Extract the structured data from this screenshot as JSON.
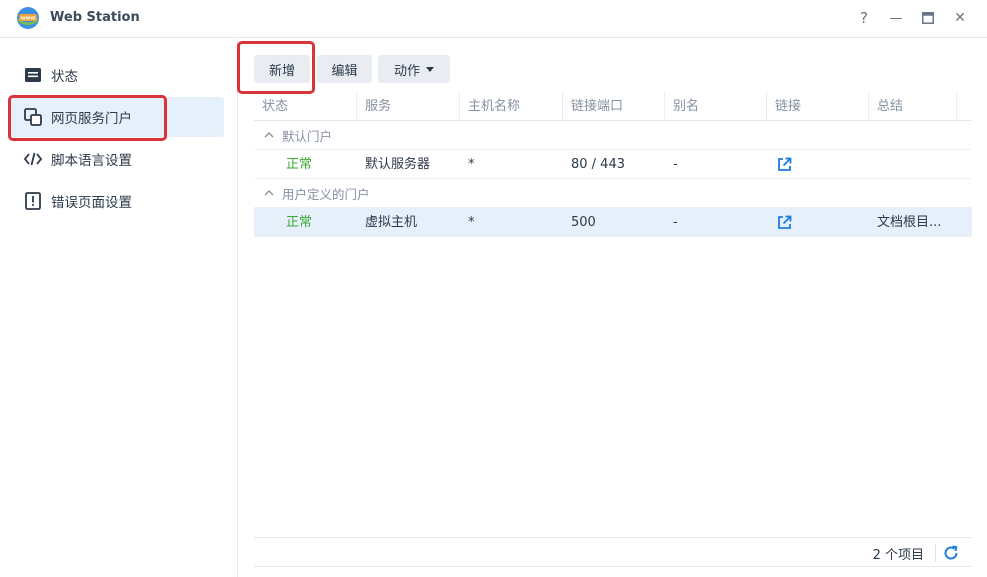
{
  "window": {
    "title": "Web Station",
    "help_glyph": "?",
    "minimize_glyph": "—",
    "close_glyph": "✕"
  },
  "sidebar": {
    "items": [
      {
        "label": "状态",
        "icon": "status-icon"
      },
      {
        "label": "网页服务门户",
        "icon": "web-portal-icon",
        "active": true
      },
      {
        "label": "脚本语言设置",
        "icon": "code-icon"
      },
      {
        "label": "错误页面设置",
        "icon": "error-page-icon"
      }
    ]
  },
  "toolbar": {
    "add_label": "新增",
    "edit_label": "编辑",
    "action_label": "动作"
  },
  "grid": {
    "columns": [
      "状态",
      "服务",
      "主机名称",
      "链接端口",
      "别名",
      "链接",
      "总结"
    ],
    "groups": [
      {
        "label": "默认门户",
        "rows": [
          {
            "status": "正常",
            "service": "默认服务器",
            "hostname": "*",
            "port": "80 / 443",
            "alias": "-",
            "summary": ""
          }
        ]
      },
      {
        "label": "用户定义的门户",
        "rows": [
          {
            "status": "正常",
            "service": "虚拟主机",
            "hostname": "*",
            "port": "500",
            "alias": "-",
            "summary": "文档根目..."
          }
        ]
      }
    ]
  },
  "footer": {
    "item_count": "2 个项目"
  },
  "colors": {
    "accent": "#1e7be0",
    "status_ok": "#3aa832",
    "highlight": "#d8343a",
    "selected_bg": "#e6f0fb"
  }
}
